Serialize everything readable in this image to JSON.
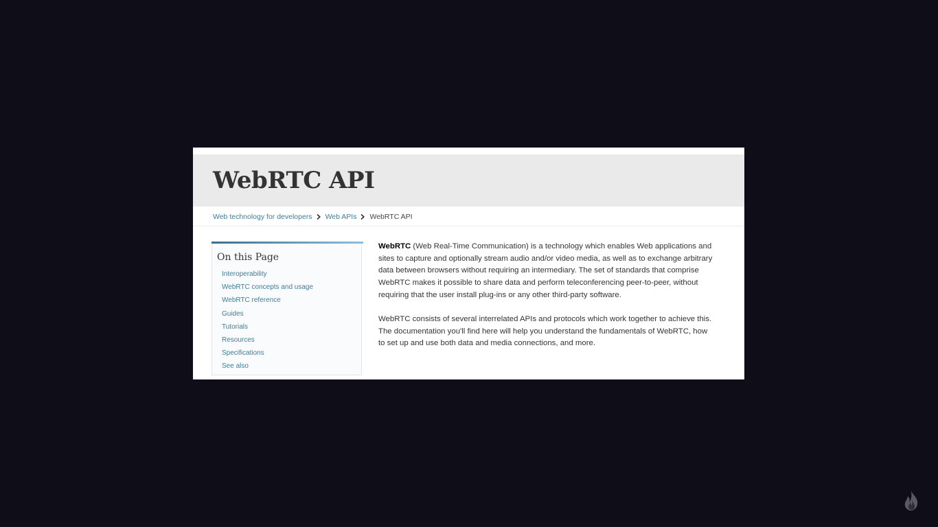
{
  "page": {
    "title": "WebRTC API"
  },
  "breadcrumb": {
    "items": [
      {
        "label": "Web technology for developers"
      },
      {
        "label": "Web APIs"
      },
      {
        "label": "WebRTC API"
      }
    ]
  },
  "toc": {
    "heading": "On this Page",
    "items": [
      {
        "label": "Interoperability"
      },
      {
        "label": "WebRTC concepts and usage"
      },
      {
        "label": "WebRTC reference"
      },
      {
        "label": "Guides"
      },
      {
        "label": "Tutorials"
      },
      {
        "label": "Resources"
      },
      {
        "label": "Specifications"
      },
      {
        "label": "See also"
      }
    ]
  },
  "content": {
    "p1_strong": "WebRTC",
    "p1_rest": " (Web Real-Time Communication) is a technology which enables Web applications and sites to capture and optionally stream audio and/or video media, as well as to exchange arbitrary data between browsers without requiring an intermediary. The set of standards that comprise WebRTC makes it possible to share data and perform teleconferencing peer-to-peer, without requiring that the user install plug-ins or any other third-party software.",
    "p2": "WebRTC consists of several interrelated APIs and protocols which work together to achieve this. The documentation you'll find here will help you understand the fundamentals of WebRTC, how to set up and use both data and media connections, and more."
  },
  "icons": {
    "breadcrumb_separator": "chevron-right-icon",
    "corner_logo": "flame-logo-icon"
  },
  "colors": {
    "background": "#0e0d18",
    "link": "#3d7e9a",
    "title_bar": "#eaeaea"
  }
}
